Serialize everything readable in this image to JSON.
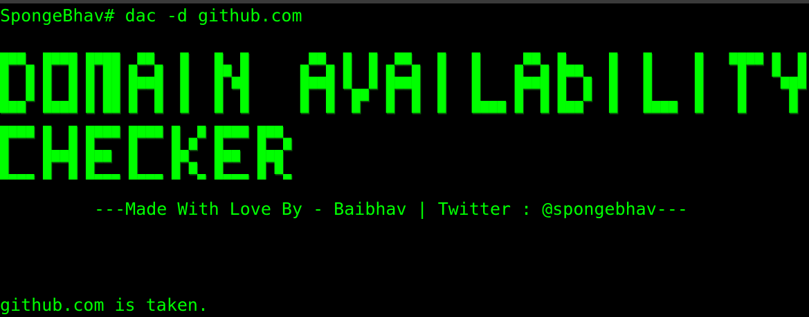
{
  "terminal": {
    "prompt": "SpongeBhav#",
    "command": "dac -d github.com",
    "banner_lines": [
      "DOMAIN AVAILABILITY",
      "CHECKER"
    ],
    "credit": "---Made With Love By - Baibhav | Twitter : @spongebhav---",
    "result": "github.com is taken."
  },
  "colors": {
    "text": "#00ff00",
    "shadow": "#0a4a0a",
    "background": "#000000"
  }
}
